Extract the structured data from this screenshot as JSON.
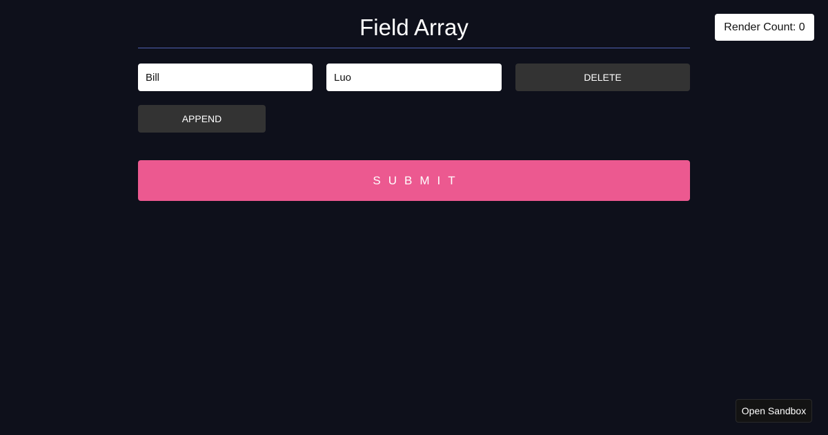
{
  "header": {
    "title": "Field Array",
    "render_count": "Render Count: 0"
  },
  "form": {
    "fields": [
      {
        "first_name": "Bill",
        "last_name": "Luo",
        "delete_label": "DELETE"
      }
    ],
    "append_label": "APPEND",
    "submit_label": "SUBMIT"
  },
  "footer": {
    "sandbox_label": "Open Sandbox"
  },
  "colors": {
    "background": "#0e101b",
    "accent": "#ec5990",
    "divider": "#5163b4",
    "button_dark": "#333333"
  }
}
